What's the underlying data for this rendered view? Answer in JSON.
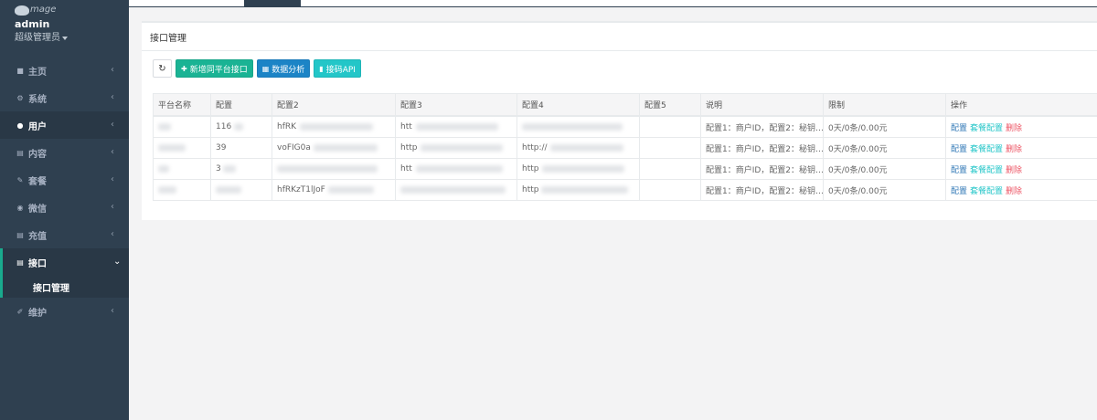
{
  "brand": {
    "logo_text": "mage"
  },
  "user": {
    "name": "admin",
    "role": "超级管理员"
  },
  "nav": {
    "items": [
      {
        "label": "主页",
        "icon": "home-icon"
      },
      {
        "label": "系统",
        "icon": "cogs-icon"
      },
      {
        "label": "用户",
        "icon": "users-icon"
      },
      {
        "label": "内容",
        "icon": "file-icon"
      },
      {
        "label": "套餐",
        "icon": "edit-icon"
      },
      {
        "label": "微信",
        "icon": "wechat-icon"
      },
      {
        "label": "充值",
        "icon": "file-icon"
      },
      {
        "label": "接口",
        "icon": "file-icon"
      },
      {
        "label": "维护",
        "icon": "wrench-icon"
      }
    ],
    "sub_item": "接口管理"
  },
  "panel": {
    "title": "接口管理"
  },
  "toolbar": {
    "refresh_icon": "refresh-icon",
    "add_label": "新增同平台接口",
    "analysis_label": "数据分析",
    "api_label": "接码API"
  },
  "table": {
    "headers": [
      "平台名称",
      "配置",
      "配置2",
      "配置3",
      "配置4",
      "配置5",
      "说明",
      "限制",
      "操作"
    ],
    "rows": [
      {
        "c1": "116",
        "c2": "hfRK",
        "c3": "htt",
        "c4": "",
        "desc": "配置1：商户ID，配置2：秘钥…",
        "limit": "0天/0条/0.00元"
      },
      {
        "c1": "39",
        "c2": "voFIG0a",
        "c3": "http",
        "c4": "http://",
        "desc": "配置1：商户ID，配置2：秘钥…",
        "limit": "0天/0条/0.00元"
      },
      {
        "c1": "3",
        "c2": "",
        "c3": "htt",
        "c4": "http",
        "desc": "配置1：商户ID，配置2：秘钥…",
        "limit": "0天/0条/0.00元"
      },
      {
        "c1": "",
        "c2": "hfRKzT1lJoF",
        "c3": "",
        "c4": "http",
        "desc": "配置1：商户ID，配置2：秘钥…",
        "limit": "0天/0条/0.00元"
      }
    ],
    "actions": {
      "config": "配置",
      "package": "套餐配置",
      "delete": "删除"
    }
  }
}
